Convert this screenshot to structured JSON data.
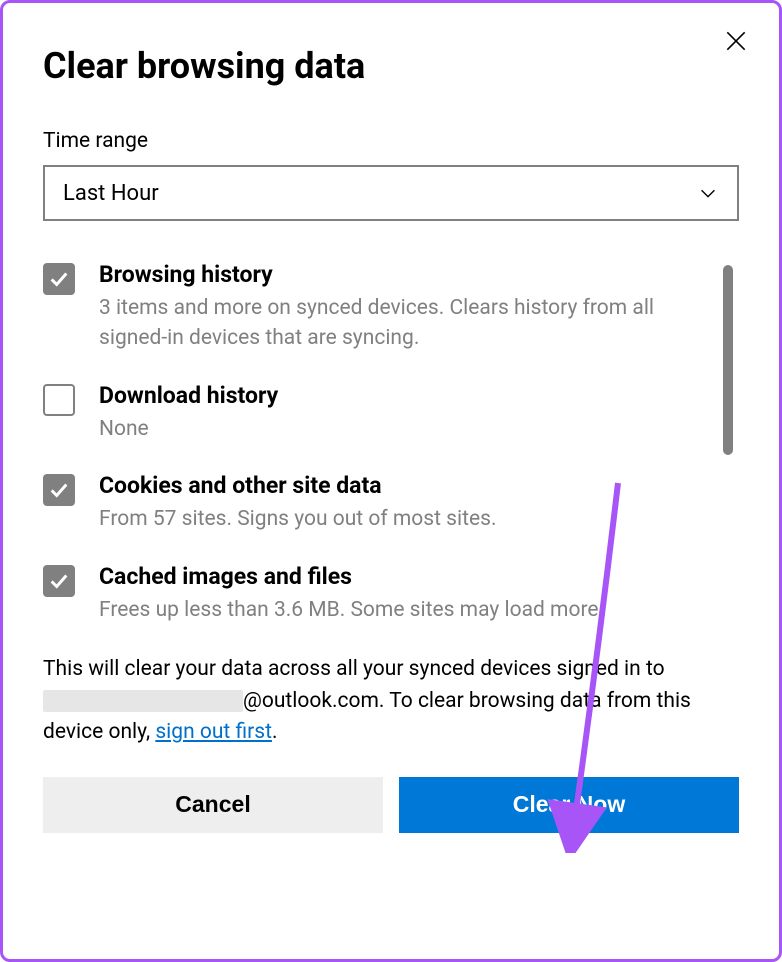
{
  "dialog": {
    "title": "Clear browsing data",
    "time_range_label": "Time range",
    "time_range_value": "Last Hour"
  },
  "options": [
    {
      "checked": true,
      "title": "Browsing history",
      "desc": "3 items and more on synced devices. Clears history from all signed-in devices that are syncing."
    },
    {
      "checked": false,
      "title": "Download history",
      "desc": "None"
    },
    {
      "checked": true,
      "title": "Cookies and other site data",
      "desc": "From 57 sites. Signs you out of most sites."
    },
    {
      "checked": true,
      "title": "Cached images and files",
      "desc": "Frees up less than 3.6 MB. Some sites may load more"
    }
  ],
  "sync_notice": {
    "prefix": "This will clear your data across all your synced devices signed in to ",
    "email_suffix": "@outlook.com. To clear browsing data from this device only, ",
    "link_text": "sign out first",
    "period": "."
  },
  "buttons": {
    "cancel": "Cancel",
    "clear": "Clear Now"
  }
}
